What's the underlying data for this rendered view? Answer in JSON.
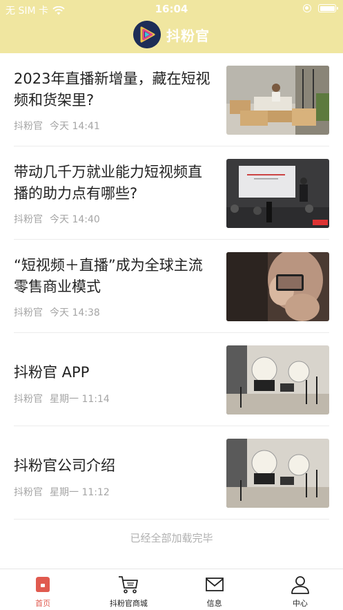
{
  "status_bar": {
    "carrier": "无 SIM 卡",
    "time": "16:04"
  },
  "header": {
    "title": "抖粉官"
  },
  "articles": [
    {
      "title": "2023年直播新增量，藏在短视频和货架里?",
      "source": "抖粉官",
      "time": "今天 14:41"
    },
    {
      "title": "带动几千万就业能力短视频直播的助力点有哪些?",
      "source": "抖粉官",
      "time": "今天 14:40"
    },
    {
      "title": "“短视频＋直播”成为全球主流零售商业模式",
      "source": "抖粉官",
      "time": "今天 14:38"
    },
    {
      "title": "抖粉官 APP",
      "source": "抖粉官",
      "time": "星期一 11:14"
    },
    {
      "title": "抖粉官公司介绍",
      "source": "抖粉官",
      "time": "星期一 11:12"
    }
  ],
  "end_text": "已经全部加载完毕",
  "tabbar": [
    {
      "label": "首页",
      "icon": "home-icon",
      "active": true
    },
    {
      "label": "抖粉官商城",
      "icon": "cart-icon",
      "active": false
    },
    {
      "label": "信息",
      "icon": "mail-icon",
      "active": false
    },
    {
      "label": "中心",
      "icon": "user-icon",
      "active": false
    }
  ],
  "colors": {
    "header_bg": "#f0e6a0",
    "accent": "#e05a4f",
    "meta_text": "#a5a5a5"
  }
}
